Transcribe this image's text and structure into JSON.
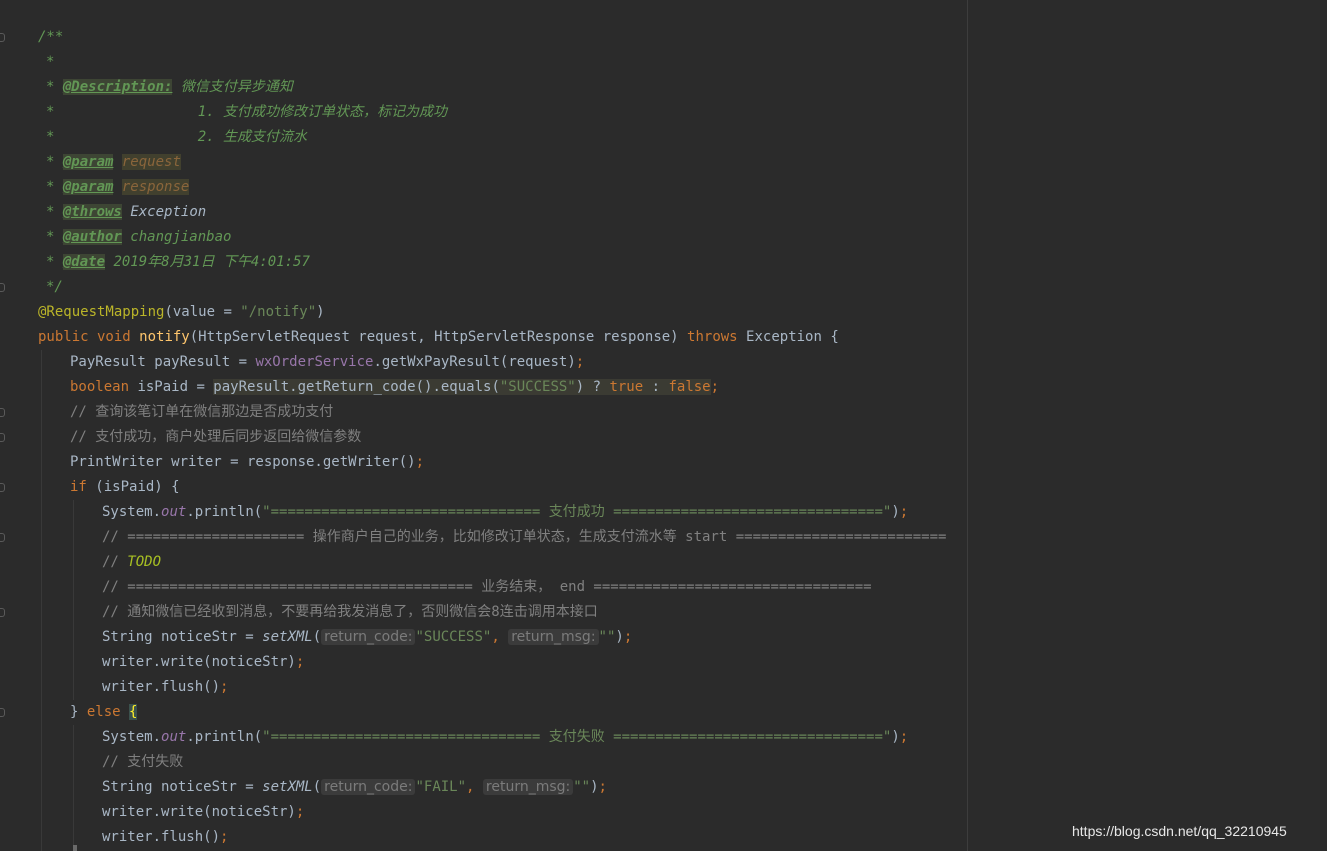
{
  "lines": [
    {
      "indent": 38,
      "tokens": [
        {
          "t": "/**",
          "c": "docc"
        }
      ]
    },
    {
      "indent": 46,
      "tokens": [
        {
          "t": "*",
          "c": "docc"
        }
      ]
    },
    {
      "indent": 46,
      "tokens": [
        {
          "t": "* ",
          "c": "docc"
        },
        {
          "t": "@Description:",
          "c": "doctag"
        },
        {
          "t": " 微信支付异步通知",
          "c": "docc"
        }
      ]
    },
    {
      "indent": 46,
      "tokens": [
        {
          "t": "*                 1. 支付成功修改订单状态，标记为成功",
          "c": "docc"
        }
      ]
    },
    {
      "indent": 46,
      "tokens": [
        {
          "t": "*                 2. 生成支付流水",
          "c": "docc"
        }
      ]
    },
    {
      "indent": 46,
      "tokens": [
        {
          "t": "* ",
          "c": "docc"
        },
        {
          "t": "@param",
          "c": "doctag"
        },
        {
          "t": " ",
          "c": "docc"
        },
        {
          "t": "request",
          "c": "docparam"
        }
      ]
    },
    {
      "indent": 46,
      "tokens": [
        {
          "t": "* ",
          "c": "docc"
        },
        {
          "t": "@param",
          "c": "doctag"
        },
        {
          "t": " ",
          "c": "docc"
        },
        {
          "t": "response",
          "c": "docparam"
        }
      ]
    },
    {
      "indent": 46,
      "tokens": [
        {
          "t": "* ",
          "c": "docc"
        },
        {
          "t": "@throws",
          "c": "doctag"
        },
        {
          "t": " ",
          "c": "docc"
        },
        {
          "t": "Exception",
          "c": "docval"
        }
      ]
    },
    {
      "indent": 46,
      "tokens": [
        {
          "t": "* ",
          "c": "docc"
        },
        {
          "t": "@author",
          "c": "doctag"
        },
        {
          "t": " changjianbao",
          "c": "docval2"
        }
      ]
    },
    {
      "indent": 46,
      "tokens": [
        {
          "t": "* ",
          "c": "docc"
        },
        {
          "t": "@date",
          "c": "doctag"
        },
        {
          "t": " 2019年8月31日 下午4:01:57",
          "c": "docval2"
        }
      ]
    },
    {
      "indent": 46,
      "tokens": [
        {
          "t": "*/",
          "c": "docc"
        }
      ]
    },
    {
      "indent": 38,
      "tokens": [
        {
          "t": "@RequestMapping",
          "c": "annot"
        },
        {
          "t": "(value = ",
          "c": "plain"
        },
        {
          "t": "\"/notify\"",
          "c": "str"
        },
        {
          "t": ")",
          "c": "plain"
        }
      ]
    },
    {
      "indent": 38,
      "tokens": [
        {
          "t": "public void ",
          "c": "kw"
        },
        {
          "t": "notify",
          "c": "fn"
        },
        {
          "t": "(HttpServletRequest request, HttpServletResponse response) ",
          "c": "plain"
        },
        {
          "t": "throws ",
          "c": "kw"
        },
        {
          "t": "Exception {",
          "c": "plain"
        }
      ]
    },
    {
      "indent": 70,
      "tokens": [
        {
          "t": "PayResult payResult = ",
          "c": "plain"
        },
        {
          "t": "wxOrderService",
          "c": "field"
        },
        {
          "t": ".getWxPayResult(request)",
          "c": "plain"
        },
        {
          "t": ";",
          "c": "kw"
        }
      ]
    },
    {
      "indent": 70,
      "tokens": [
        {
          "t": "boolean ",
          "c": "kw"
        },
        {
          "t": "isPaid = ",
          "c": "plain"
        },
        {
          "t": "payResult.getReturn_code().equals(",
          "c": "plain",
          "hl": true
        },
        {
          "t": "\"SUCCESS\"",
          "c": "str",
          "hl": true
        },
        {
          "t": ") ? ",
          "c": "plain",
          "hl": true
        },
        {
          "t": "true ",
          "c": "kw",
          "hl": true
        },
        {
          "t": ": ",
          "c": "plain",
          "hl": true
        },
        {
          "t": "false",
          "c": "kw",
          "hl": true
        },
        {
          "t": ";",
          "c": "kw"
        }
      ]
    },
    {
      "indent": 70,
      "tokens": [
        {
          "t": "// 查询该笔订单在微信那边是否成功支付",
          "c": "cm"
        }
      ]
    },
    {
      "indent": 70,
      "tokens": [
        {
          "t": "// 支付成功，商户处理后同步返回给微信参数",
          "c": "cm"
        }
      ]
    },
    {
      "indent": 70,
      "tokens": [
        {
          "t": "PrintWriter writer = response.getWriter()",
          "c": "plain"
        },
        {
          "t": ";",
          "c": "kw"
        }
      ]
    },
    {
      "indent": 70,
      "tokens": [
        {
          "t": "if ",
          "c": "kw"
        },
        {
          "t": "(isPaid) {",
          "c": "plain"
        }
      ]
    },
    {
      "indent": 102,
      "tokens": [
        {
          "t": "System.",
          "c": "plain"
        },
        {
          "t": "out",
          "c": "sfield"
        },
        {
          "t": ".println(",
          "c": "plain"
        },
        {
          "t": "\"================================ 支付成功 ================================\"",
          "c": "str"
        },
        {
          "t": ")",
          "c": "plain"
        },
        {
          "t": ";",
          "c": "kw"
        }
      ]
    },
    {
      "indent": 102,
      "tokens": [
        {
          "t": "// ===================== 操作商户自己的业务，比如修改订单状态，生成支付流水等 start =========================",
          "c": "cm"
        }
      ]
    },
    {
      "indent": 102,
      "tokens": [
        {
          "t": "// ",
          "c": "cm"
        },
        {
          "t": "TODO",
          "c": "todo"
        }
      ]
    },
    {
      "indent": 102,
      "tokens": [
        {
          "t": "// ========================================= 业务结束， end =================================",
          "c": "cm"
        }
      ]
    },
    {
      "indent": 102,
      "tokens": [
        {
          "t": "// 通知微信已经收到消息，不要再给我发消息了，否则微信会8连击调用本接口",
          "c": "cm"
        }
      ]
    },
    {
      "indent": 102,
      "tokens": [
        {
          "t": "String noticeStr = ",
          "c": "plain"
        },
        {
          "t": "setXML",
          "c": "sfn"
        },
        {
          "t": "(",
          "c": "plain"
        },
        {
          "t": "return_code:",
          "c": "hint"
        },
        {
          "t": "\"SUCCESS\"",
          "c": "str"
        },
        {
          "t": ", ",
          "c": "kw"
        },
        {
          "t": "return_msg:",
          "c": "hint"
        },
        {
          "t": "\"\"",
          "c": "str"
        },
        {
          "t": ")",
          "c": "plain"
        },
        {
          "t": ";",
          "c": "kw"
        }
      ]
    },
    {
      "indent": 102,
      "tokens": [
        {
          "t": "writer.write(noticeStr)",
          "c": "plain"
        },
        {
          "t": ";",
          "c": "kw"
        }
      ]
    },
    {
      "indent": 102,
      "tokens": [
        {
          "t": "writer.flush()",
          "c": "plain"
        },
        {
          "t": ";",
          "c": "kw"
        }
      ]
    },
    {
      "indent": 70,
      "tokens": [
        {
          "t": "} ",
          "c": "plain"
        },
        {
          "t": "else ",
          "c": "kw"
        },
        {
          "t": "{",
          "c": "brace"
        }
      ]
    },
    {
      "indent": 102,
      "tokens": [
        {
          "t": "System.",
          "c": "plain"
        },
        {
          "t": "out",
          "c": "sfield"
        },
        {
          "t": ".println(",
          "c": "plain"
        },
        {
          "t": "\"================================ 支付失败 ================================\"",
          "c": "str"
        },
        {
          "t": ")",
          "c": "plain"
        },
        {
          "t": ";",
          "c": "kw"
        }
      ]
    },
    {
      "indent": 102,
      "tokens": [
        {
          "t": "// 支付失败",
          "c": "cm"
        }
      ]
    },
    {
      "indent": 102,
      "tokens": [
        {
          "t": "String noticeStr = ",
          "c": "plain"
        },
        {
          "t": "setXML",
          "c": "sfn"
        },
        {
          "t": "(",
          "c": "plain"
        },
        {
          "t": "return_code:",
          "c": "hint"
        },
        {
          "t": "\"FAIL\"",
          "c": "str"
        },
        {
          "t": ", ",
          "c": "kw"
        },
        {
          "t": "return_msg:",
          "c": "hint"
        },
        {
          "t": "\"\"",
          "c": "str"
        },
        {
          "t": ")",
          "c": "plain"
        },
        {
          "t": ";",
          "c": "kw"
        }
      ]
    },
    {
      "indent": 102,
      "tokens": [
        {
          "t": "writer.write(noticeStr)",
          "c": "plain"
        },
        {
          "t": ";",
          "c": "kw"
        }
      ]
    },
    {
      "indent": 102,
      "tokens": [
        {
          "t": "writer.flush()",
          "c": "plain"
        },
        {
          "t": ";",
          "c": "kw"
        }
      ]
    }
  ],
  "watermark": "https://blog.csdn.net/qq_32210945"
}
